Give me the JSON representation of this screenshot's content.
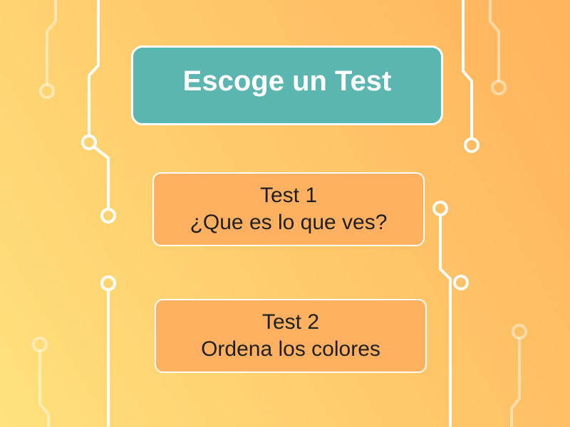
{
  "header": {
    "title": "Escoge un Test"
  },
  "tests": [
    {
      "name": "Test 1",
      "description": "¿Que es lo que ves?"
    },
    {
      "name": "Test 2",
      "description": "Ordena los colores"
    }
  ],
  "colors": {
    "background_start": "#ffe27d",
    "background_end": "#ffb35c",
    "title_panel": "#5bb5b0",
    "test_button": "#ffb060",
    "circuit_line": "#ffffff"
  }
}
